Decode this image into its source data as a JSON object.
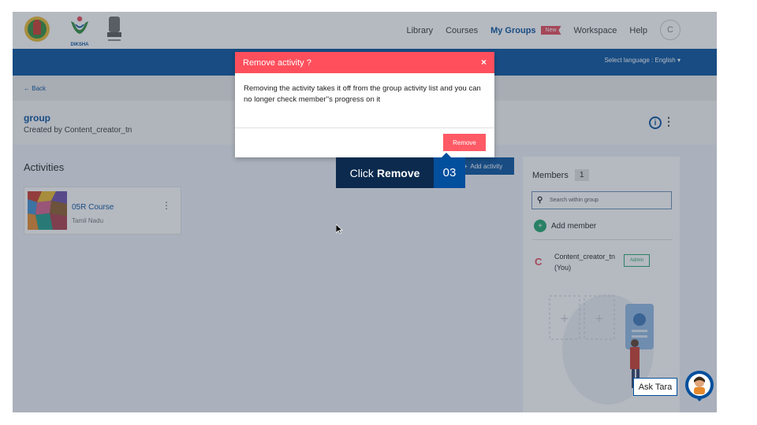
{
  "header": {
    "logos": [
      "state-emblem-icon",
      "diksha-logo",
      "national-emblem-icon"
    ],
    "diksha_text": "DIKSHA",
    "nav": {
      "library": "Library",
      "courses": "Courses",
      "my_groups": "My Groups",
      "new_badge": "New",
      "workspace": "Workspace",
      "help": "Help"
    },
    "avatar_letter": "C",
    "language_label": "Select language :",
    "language_value": "English",
    "active_color": "#024f9d"
  },
  "back_label": "Back",
  "group": {
    "title": "group",
    "created_by": "Created by Content_creator_tn"
  },
  "activities": {
    "title": "Activities",
    "add_label": "Add activity",
    "items": [
      {
        "name": "05R Course",
        "subtitle": "Tamil Nadu"
      }
    ]
  },
  "members": {
    "title": "Members",
    "count": "1",
    "search_placeholder": "Search within group",
    "add_label": "Add member",
    "list": [
      {
        "initial": "C",
        "name": "Content_creator_tn (You)",
        "role": "Admin"
      }
    ]
  },
  "ask_tara": "Ask Tara",
  "dialog": {
    "title": "Remove activity ?",
    "close_icon": "×",
    "body": "Removing the activity takes it off from the group activity list and you can no longer check member''s progress on it",
    "remove_label": "Remove",
    "header_color": "#ff4f5c"
  },
  "callout": {
    "prefix": "Click",
    "action": "Remove",
    "step": "03"
  }
}
